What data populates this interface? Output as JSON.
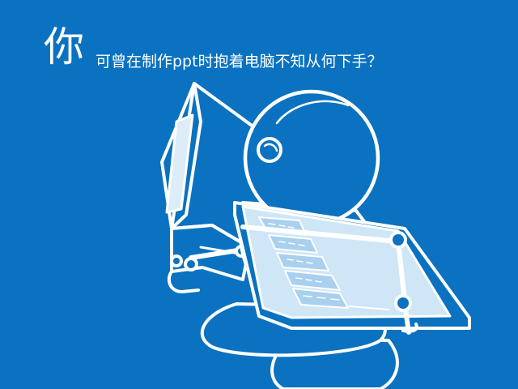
{
  "slide": {
    "headline_first_char": "你",
    "headline_rest": "可曾在制作ppt时抱着电脑不知从何下手？"
  },
  "illustration": {
    "subject": "figure-hugging-computer",
    "colors": {
      "background": "#0a72c0",
      "line": "#ffffff",
      "screen_fill": "#cfe6f7",
      "screen_fill_dark": "#a9d0ee"
    }
  }
}
